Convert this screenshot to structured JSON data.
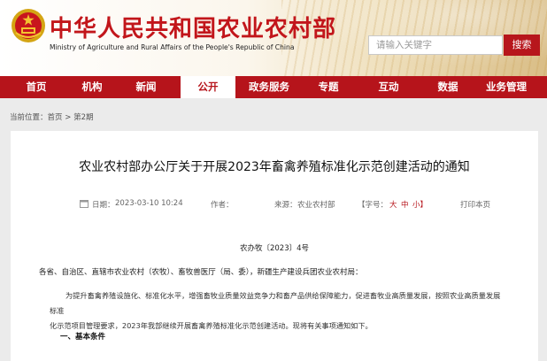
{
  "header": {
    "site_title": "中华人民共和国农业农村部",
    "site_subtitle": "Ministry of Agriculture and Rural Affairs of the People's Republic of China",
    "search_placeholder": "请输入关键字",
    "search_button": "搜索"
  },
  "nav": [
    {
      "label": "首页"
    },
    {
      "label": "机构"
    },
    {
      "label": "新闻"
    },
    {
      "label": "公开",
      "active": true
    },
    {
      "label": "政务服务"
    },
    {
      "label": "专题"
    },
    {
      "label": "互动"
    },
    {
      "label": "数据"
    },
    {
      "label": "业务管理"
    }
  ],
  "breadcrumb": {
    "prefix": "当前位置：",
    "home": "首页",
    "sep": " > ",
    "current": "第2期"
  },
  "article": {
    "title": "农业农村部办公厅关于开展2023年畜禽养殖标准化示范创建活动的通知",
    "date_label": "日期：",
    "date_value": "2023-03-10 10:24",
    "author_label": "作者：",
    "source_label": "来源：",
    "source_value": "农业农村部",
    "font_label": "【字号：",
    "font_large": "大",
    "font_medium": "中",
    "font_small": "小】",
    "print_label": "打印本页",
    "doc_number": "农办牧〔2023〕4号",
    "recipients": "各省、自治区、直辖市农业农村（农牧）、畜牧兽医厅（局、委），新疆生产建设兵团农业农村局：",
    "body_line1": "为提升畜禽养殖设施化、标准化水平，增强畜牧业质量效益竞争力和畜产品供给保障能力，促进畜牧业高质量发展，按照农业高质量发展标准",
    "body_line2": "化示范项目管理要求，2023年我部继续开展畜禽养殖标准化示范创建活动。现将有关事项通知如下。",
    "section1": "一、基本条件"
  },
  "colors": {
    "brand_red": "#b6141b",
    "title_red": "#c2161b"
  },
  "icons": [
    "national-emblem-icon",
    "calendar-icon"
  ]
}
